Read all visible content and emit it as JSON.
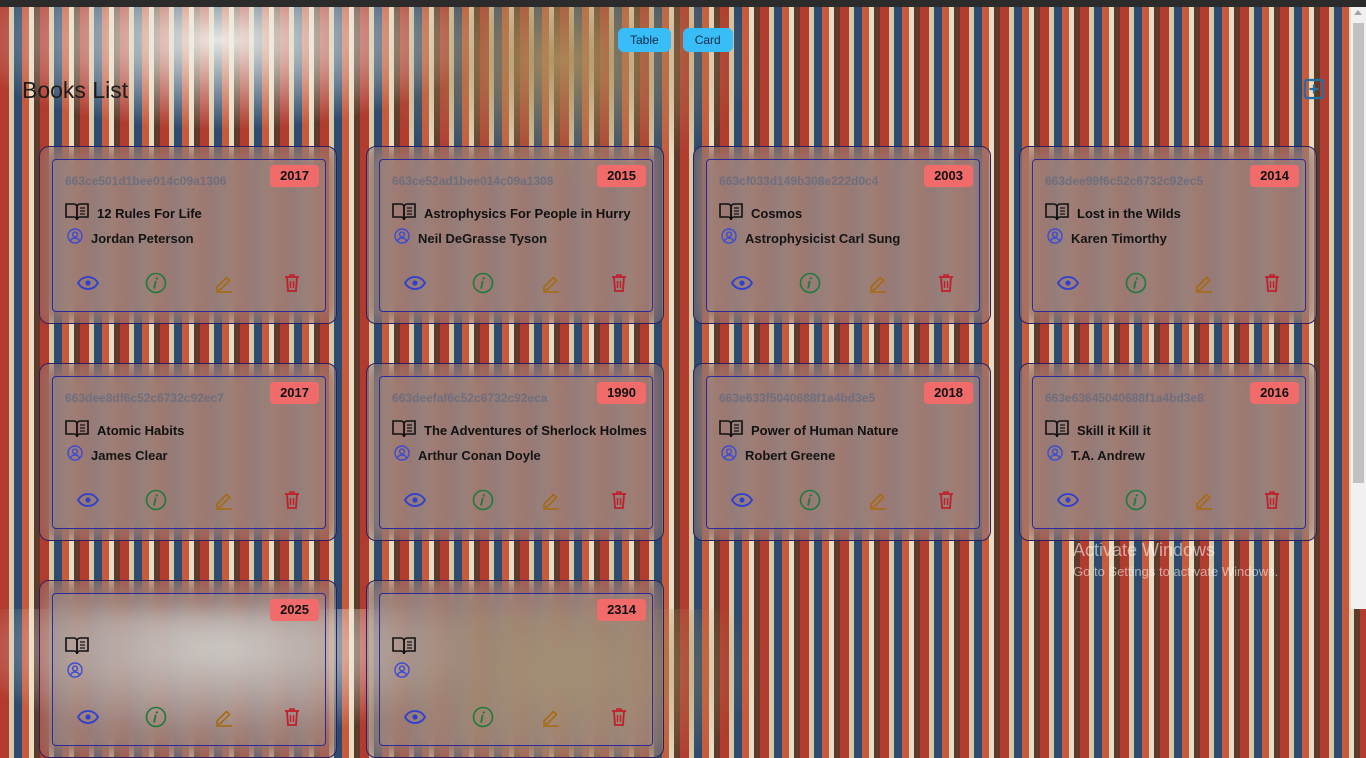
{
  "view_toggle": {
    "table_label": "Table",
    "card_label": "Card"
  },
  "page": {
    "title": "Books List"
  },
  "colors": {
    "year_badge": "#f26b6b",
    "view_button": "#38bdf8",
    "view_icon": "#2f3fcf",
    "info_icon": "#1e7a3a",
    "edit_icon": "#a56a12",
    "delete_icon": "#c0202a"
  },
  "icons": {
    "add": "plus-square-icon",
    "book": "open-book-icon",
    "author": "user-circle-icon",
    "view": "eye-icon",
    "info": "info-icon",
    "edit": "pencil-icon",
    "delete": "trash-icon"
  },
  "books": [
    {
      "id": "663ce501d1bee014c09a1306",
      "year": "2017",
      "title": "12 Rules For Life",
      "author": "Jordan Peterson"
    },
    {
      "id": "663ce52ad1bee014c09a1308",
      "year": "2015",
      "title": "Astrophysics For People in Hurry",
      "author": "Neil DeGrasse Tyson"
    },
    {
      "id": "663cf033d149b308e222d0c4",
      "year": "2003",
      "title": "Cosmos",
      "author": "Astrophysicist Carl Sung"
    },
    {
      "id": "663dee99f6c52c6732c92ec5",
      "year": "2014",
      "title": "Lost in the Wilds",
      "author": "Karen Timorthy"
    },
    {
      "id": "663dee8df6c52c6732c92ec7",
      "year": "2017",
      "title": "Atomic Habits",
      "author": "James Clear"
    },
    {
      "id": "663deefaf6c52c6732c92eca",
      "year": "1990",
      "title": "The Adventures of Sherlock Holmes",
      "author": "Arthur Conan Doyle"
    },
    {
      "id": "663e633f5040688f1a4bd3e5",
      "year": "2018",
      "title": "Power of Human Nature",
      "author": "Robert Greene"
    },
    {
      "id": "663e63645040688f1a4bd3e8",
      "year": "2016",
      "title": "Skill it Kill it",
      "author": "T.A. Andrew"
    },
    {
      "id": "",
      "year": "2025",
      "title": "",
      "author": ""
    },
    {
      "id": "",
      "year": "2314",
      "title": "",
      "author": ""
    }
  ],
  "watermark": {
    "line1": "Activate Windows",
    "line2": "Go to Settings to activate Windows."
  }
}
